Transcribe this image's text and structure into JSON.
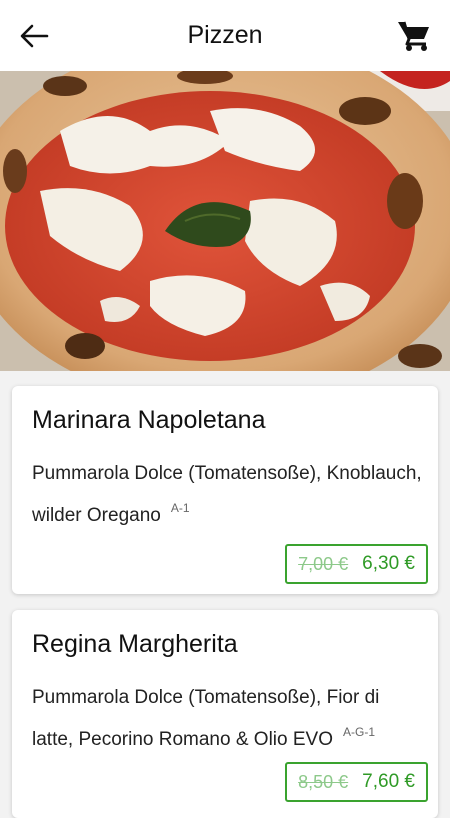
{
  "header": {
    "title": "Pizzen",
    "back_icon": "arrow-left-icon",
    "cart_icon": "shopping-cart-icon"
  },
  "hero": {
    "image": "pizza-margherita-photo"
  },
  "colors": {
    "accent_green": "#3aa32f",
    "old_price_green": "#8dc98a",
    "background": "#f2f2f2"
  },
  "products": [
    {
      "name": "Marinara Napoletana",
      "description": "Pummarola Dolce (Tomatensoße), Knoblauch, wilder Oregano",
      "allergens": "A-1",
      "old_price": "7,00 €",
      "price": "6,30 €"
    },
    {
      "name": "Regina Margherita",
      "description": "Pummarola Dolce (Tomatensoße), Fior di latte, Pecorino Romano & Olio EVO",
      "allergens": "A-G-1",
      "old_price": "8,50 €",
      "price": "7,60 €"
    }
  ]
}
